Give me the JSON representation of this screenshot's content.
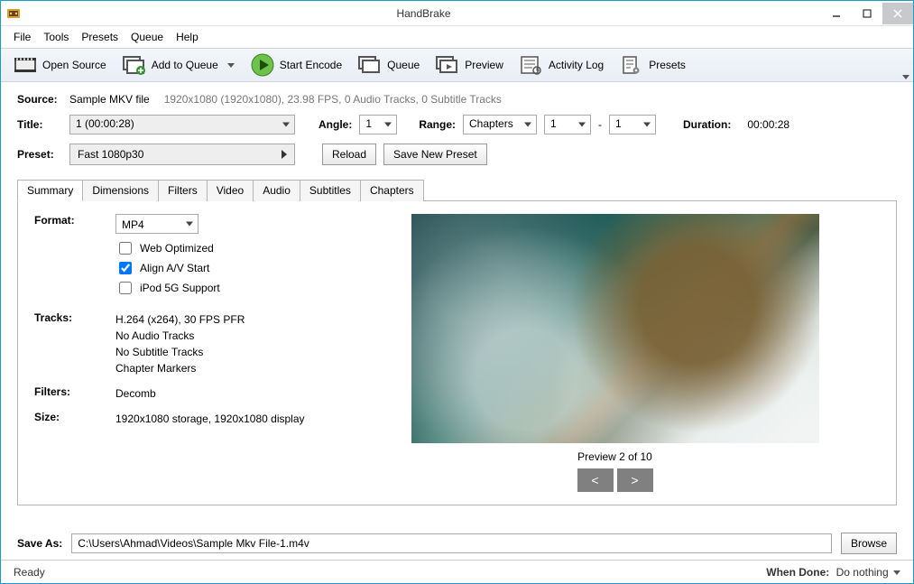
{
  "window": {
    "title": "HandBrake"
  },
  "menu": {
    "file": "File",
    "tools": "Tools",
    "presets": "Presets",
    "queue": "Queue",
    "help": "Help"
  },
  "toolbar": {
    "open_source": "Open Source",
    "add_to_queue": "Add to Queue",
    "start_encode": "Start Encode",
    "queue": "Queue",
    "preview": "Preview",
    "activity_log": "Activity Log",
    "presets": "Presets"
  },
  "source": {
    "label": "Source:",
    "name": "Sample MKV file",
    "info": "1920x1080 (1920x1080), 23.98 FPS, 0 Audio Tracks, 0 Subtitle Tracks"
  },
  "title_row": {
    "title_label": "Title:",
    "title_value": "1  (00:00:28)",
    "angle_label": "Angle:",
    "angle_value": "1",
    "range_label": "Range:",
    "range_value": "Chapters",
    "chap_from": "1",
    "dash": "-",
    "chap_to": "1",
    "duration_label": "Duration:",
    "duration_value": "00:00:28"
  },
  "preset_row": {
    "label": "Preset:",
    "value": "Fast 1080p30",
    "reload": "Reload",
    "save_new": "Save New Preset"
  },
  "tabs": {
    "summary": "Summary",
    "dimensions": "Dimensions",
    "filters": "Filters",
    "video": "Video",
    "audio": "Audio",
    "subtitles": "Subtitles",
    "chapters": "Chapters"
  },
  "summary": {
    "format_label": "Format:",
    "format_value": "MP4",
    "web_optimized": "Web Optimized",
    "align_av": "Align A/V Start",
    "ipod5g": "iPod 5G Support",
    "tracks_label": "Tracks:",
    "tracks_line1": "H.264 (x264), 30 FPS PFR",
    "tracks_line2": "No Audio Tracks",
    "tracks_line3": "No Subtitle Tracks",
    "tracks_line4": "Chapter Markers",
    "filters_label": "Filters:",
    "filters_value": "Decomb",
    "size_label": "Size:",
    "size_value": "1920x1080 storage, 1920x1080 display",
    "preview_caption": "Preview 2 of 10",
    "prev": "<",
    "next": ">"
  },
  "save": {
    "label": "Save As:",
    "path": "C:\\Users\\Ahmad\\Videos\\Sample Mkv File-1.m4v",
    "browse": "Browse"
  },
  "status": {
    "ready": "Ready",
    "when_done_label": "When Done:",
    "when_done_value": "Do nothing"
  }
}
